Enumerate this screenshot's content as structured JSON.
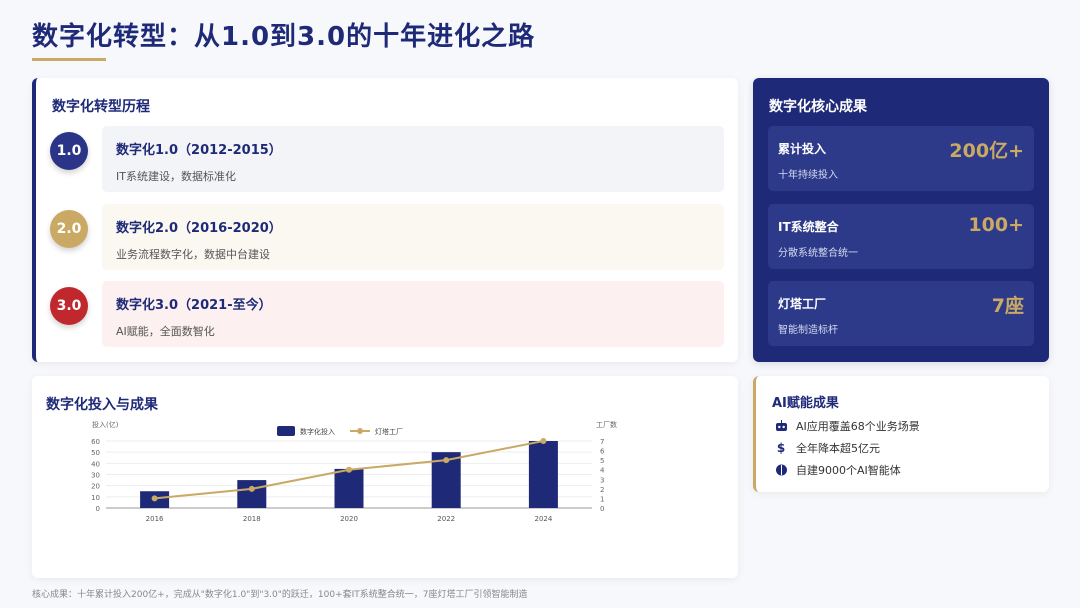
{
  "header": {
    "title": "数字化转型：从1.0到3.0的十年进化之路"
  },
  "timeline": {
    "title": "数字化转型历程",
    "stages": [
      {
        "badge": "1.0",
        "title": "数字化1.0（2012-2015）",
        "desc": "IT系统建设，数据标准化",
        "color": "#2b3486",
        "bg": "#f3f4f8"
      },
      {
        "badge": "2.0",
        "title": "数字化2.0（2016-2020）",
        "desc": "业务流程数字化，数据中台建设",
        "color": "#c9a964",
        "bg": "#fbf8f1"
      },
      {
        "badge": "3.0",
        "title": "数字化3.0（2021-至今）",
        "desc": "AI赋能，全面数智化",
        "color": "#c0282d",
        "bg": "#fcf0f0"
      }
    ]
  },
  "achievements": {
    "title": "数字化核心成果",
    "metrics": [
      {
        "label": "累计投入",
        "sub": "十年持续投入",
        "value": "200亿+"
      },
      {
        "label": "IT系统整合",
        "sub": "分散系统整合统一",
        "value": "100+"
      },
      {
        "label": "灯塔工厂",
        "sub": "智能制造标杆",
        "value": "7座"
      }
    ]
  },
  "chart": {
    "title": "数字化投入与成果"
  },
  "chart_data": {
    "type": "bar",
    "categories": [
      "2016",
      "2018",
      "2020",
      "2022",
      "2024"
    ],
    "series": [
      {
        "name": "数字化投入",
        "type": "bar",
        "axis": "left",
        "values": [
          15,
          25,
          35,
          50,
          60
        ],
        "color": "#1e2a78"
      },
      {
        "name": "灯塔工厂",
        "type": "line",
        "axis": "right",
        "values": [
          1,
          2,
          4,
          5,
          7
        ],
        "color": "#c9a964"
      }
    ],
    "ylabel": "投入(亿)",
    "y2label": "工厂数",
    "ylim": [
      0,
      60
    ],
    "y2lim": [
      0,
      7
    ],
    "yticks": [
      0,
      10,
      20,
      30,
      40,
      50,
      60
    ],
    "y2ticks": [
      0,
      1,
      2,
      3,
      4,
      5,
      6,
      7
    ],
    "grid": true,
    "legend": "top-center"
  },
  "ai": {
    "title": "AI赋能成果",
    "items": [
      {
        "icon": "robot-icon",
        "text": "AI应用覆盖68个业务场景"
      },
      {
        "icon": "dollar-icon",
        "text": "全年降本超5亿元"
      },
      {
        "icon": "brain-icon",
        "text": "自建9000个AI智能体"
      }
    ]
  },
  "footer": {
    "note": "核心成果：十年累计投入200亿+，完成从\"数字化1.0\"到\"3.0\"的跃迁，100+套IT系统整合统一，7座灯塔工厂引领智能制造"
  }
}
